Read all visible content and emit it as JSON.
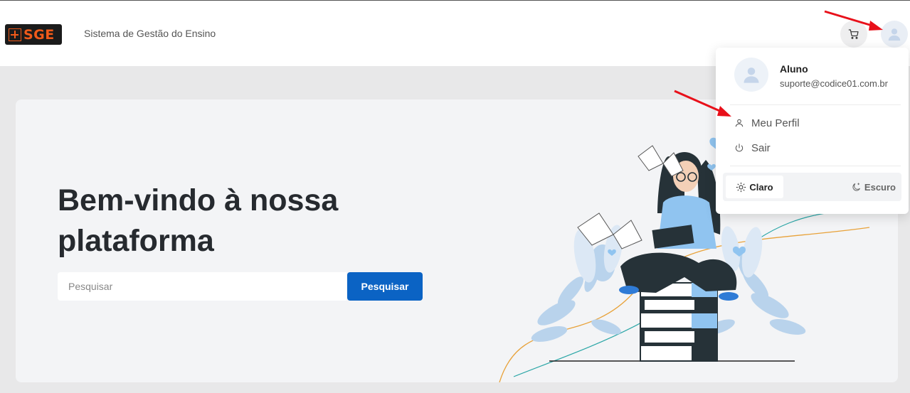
{
  "header": {
    "logo_text": "SGE",
    "app_title": "Sistema de Gestão do Ensino"
  },
  "hero": {
    "headline_line1": "Bem-vindo à nossa",
    "headline_line2": "plataforma",
    "search_placeholder": "Pesquisar",
    "search_button": "Pesquisar"
  },
  "user_menu": {
    "name": "Aluno",
    "email": "suporte@codice01.com.br",
    "items": [
      {
        "label": "Meu Perfil",
        "icon": "user-icon"
      },
      {
        "label": "Sair",
        "icon": "power-icon"
      }
    ],
    "theme": {
      "light_label": "Claro",
      "dark_label": "Escuro",
      "selected": "Claro"
    }
  },
  "colors": {
    "primary": "#0b63c4",
    "logo_accent": "#f05a1a",
    "annotation_arrow": "#e8101a"
  }
}
